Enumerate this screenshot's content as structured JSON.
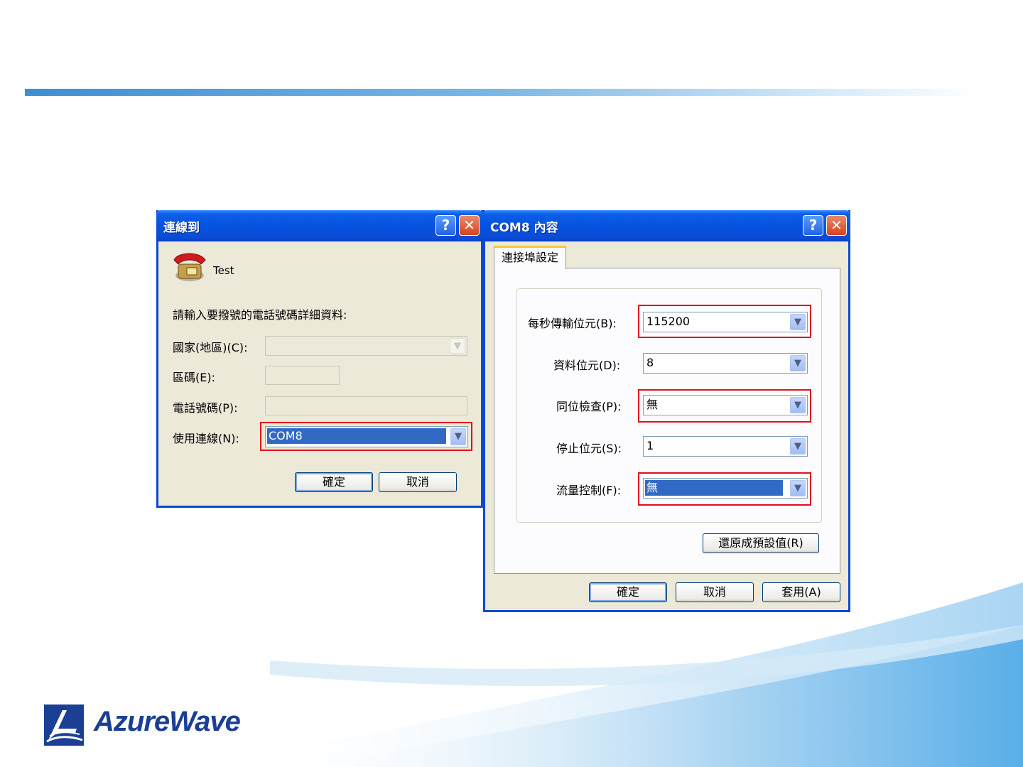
{
  "dialog_connect": {
    "title": "連線到",
    "help_button": "?",
    "close_button": "✕",
    "connection_name": "Test",
    "prompt": "請輸入要撥號的電話號碼詳細資料:",
    "country_label": "國家(地區)(C):",
    "country_value": "",
    "area_code_label": "區碼(E):",
    "area_code_value": "",
    "phone_label": "電話號碼(P):",
    "phone_value": "",
    "connect_using_label": "使用連線(N):",
    "connect_using_value": "COM8",
    "ok_button": "確定",
    "cancel_button": "取消"
  },
  "dialog_com": {
    "title": "COM8 內容",
    "help_button": "?",
    "close_button": "✕",
    "tab_label": "連接埠設定",
    "bits_per_second_label": "每秒傳輸位元(B):",
    "bits_per_second_value": "115200",
    "data_bits_label": "資料位元(D):",
    "data_bits_value": "8",
    "parity_label": "同位檢查(P):",
    "parity_value": "無",
    "stop_bits_label": "停止位元(S):",
    "stop_bits_value": "1",
    "flow_control_label": "流量控制(F):",
    "flow_control_value": "無",
    "restore_defaults_button": "還原成預設值(R)",
    "ok_button": "確定",
    "cancel_button": "取消",
    "apply_button": "套用(A)"
  },
  "logo": {
    "text": "AzureWave"
  },
  "colors": {
    "title_bar": "#0553e1",
    "highlight_box": "#e0101c",
    "selection": "#316ac5",
    "brand": "#1a3f94"
  }
}
